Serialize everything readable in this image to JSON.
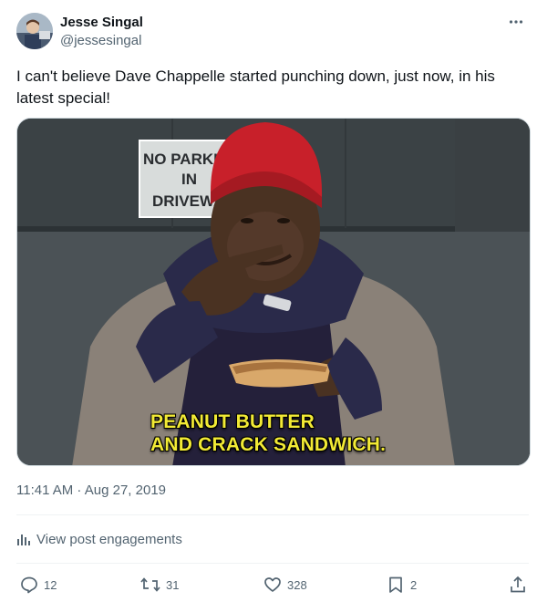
{
  "author": {
    "name": "Jesse Singal",
    "handle": "@jessesingal"
  },
  "post": {
    "text": "I can't believe Dave Chappelle started punching down, just now, in his latest special!",
    "media_caption_line1": "PEANUT BUTTER",
    "media_caption_line2": "AND CRACK SANDWICH.",
    "sign_line1": "NO PARKING",
    "sign_line2": "IN",
    "sign_line3": "DRIVEWAY",
    "timestamp": "11:41 AM · Aug 27, 2019"
  },
  "engagements": {
    "label": "View post engagements"
  },
  "actions": {
    "replies": "12",
    "reposts": "31",
    "likes": "328",
    "bookmarks": "2"
  },
  "icons": {
    "more": "more-dots-icon",
    "engagements": "bar-chart-icon",
    "reply": "reply-icon",
    "repost": "repost-icon",
    "like": "heart-icon",
    "bookmark": "bookmark-icon",
    "share": "share-icon"
  },
  "colors": {
    "text_primary": "#0f1419",
    "text_secondary": "#536471",
    "caption_yellow": "#f2ea35",
    "hat_red": "#c8202a"
  }
}
